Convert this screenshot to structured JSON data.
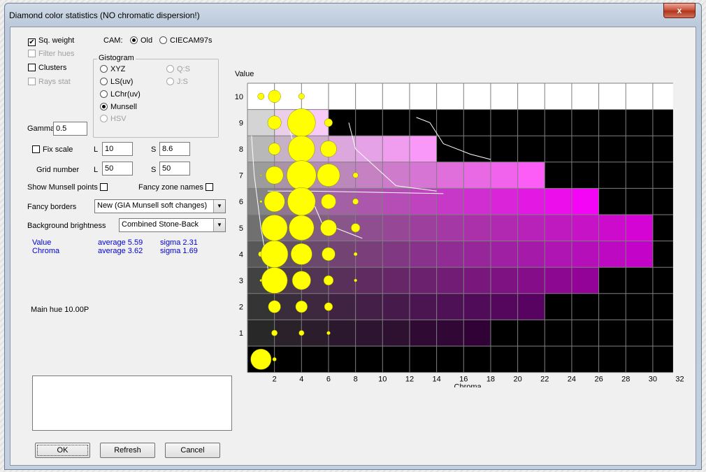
{
  "window": {
    "title": "Diamond color statistics (NO chromatic dispersion!)",
    "close_label": "x"
  },
  "options": {
    "sq_weight": {
      "label": "Sq. weight",
      "checked": true
    },
    "filter_hues": {
      "label": "Filter hues",
      "checked": false
    },
    "clusters": {
      "label": "Clusters",
      "checked": false
    },
    "rays_stat": {
      "label": "Rays stat",
      "checked": false
    },
    "cam_label": "CAM:",
    "cam_old": "Old",
    "cam_ciecam": "CIECAM97s"
  },
  "gistogram": {
    "label": "Gistogram",
    "xyz": "XYZ",
    "ls_uv": "LS(uv)",
    "lchr_uv": "LChr(uv)",
    "munsell": "Munsell",
    "hsv": "HSV",
    "qs": "Q:S",
    "js": "J:S",
    "selected": "Munsell"
  },
  "gamma": {
    "label": "Gamma",
    "value": "0.5"
  },
  "fix_scale": {
    "label": "Fix scale",
    "l_label": "L",
    "l_value": "10",
    "s_label": "S",
    "s_value": "8.6"
  },
  "grid_number": {
    "label": "Grid number",
    "l_label": "L",
    "l_value": "50",
    "s_label": "S",
    "s_value": "50"
  },
  "show_munsell_points": "Show Munsell points",
  "fancy_zone_names": "Fancy zone names",
  "fancy_borders": {
    "label": "Fancy borders",
    "value": "New (GIA Munsell soft changes)"
  },
  "background_brightness": {
    "label": "Background brightness",
    "value": "Combined Stone-Back"
  },
  "stats": {
    "value_label": "Value",
    "value_average": "average  5.59",
    "value_sigma": "sigma  2.31",
    "chroma_label": "Chroma",
    "chroma_average": "average  3.62",
    "chroma_sigma": "sigma  1.69"
  },
  "main_hue": "Main hue 10.00P",
  "buttons": {
    "ok": "OK",
    "refresh": "Refresh",
    "cancel": "Cancel"
  },
  "colors": {
    "bubble": "#ffff00",
    "bubble_outline": "#8a8a00",
    "grid_line": "#7f7f7f",
    "curve": "#ffffff"
  },
  "chart_data": {
    "type": "heatmap",
    "ylabel": "Value",
    "xlabel": "Chroma",
    "x_ticks": [
      2,
      4,
      6,
      8,
      10,
      12,
      14,
      16,
      18,
      20,
      22,
      24,
      26,
      28,
      30,
      32
    ],
    "y_ticks": [
      1,
      2,
      3,
      4,
      5,
      6,
      7,
      8,
      9,
      10
    ],
    "xlim": [
      0,
      31.5
    ],
    "ylim": [
      0,
      10
    ],
    "gamut_max_chroma": {
      "0": 0,
      "1": 18,
      "2": 22,
      "3": 26,
      "4": 30,
      "5": 30,
      "6": 26,
      "7": 22,
      "8": 14,
      "9": 6,
      "10": 30
    },
    "bubbles": [
      {
        "chroma": 1,
        "value": 10,
        "size": 0.22
      },
      {
        "chroma": 2,
        "value": 10,
        "size": 0.42
      },
      {
        "chroma": 4,
        "value": 10,
        "size": 0.2
      },
      {
        "chroma": 2,
        "value": 9,
        "size": 0.46
      },
      {
        "chroma": 4,
        "value": 9,
        "size": 0.95
      },
      {
        "chroma": 6,
        "value": 9,
        "size": 0.27
      },
      {
        "chroma": 2,
        "value": 8,
        "size": 0.4
      },
      {
        "chroma": 4,
        "value": 8,
        "size": 0.9
      },
      {
        "chroma": 6,
        "value": 8,
        "size": 0.55
      },
      {
        "chroma": 1,
        "value": 7,
        "size": 0.05
      },
      {
        "chroma": 2,
        "value": 7,
        "size": 0.6
      },
      {
        "chroma": 4,
        "value": 7,
        "size": 1.0
      },
      {
        "chroma": 6,
        "value": 7,
        "size": 0.77
      },
      {
        "chroma": 8,
        "value": 7,
        "size": 0.18
      },
      {
        "chroma": 1,
        "value": 6,
        "size": 0.08
      },
      {
        "chroma": 2,
        "value": 6,
        "size": 0.7
      },
      {
        "chroma": 4,
        "value": 6,
        "size": 0.95
      },
      {
        "chroma": 6,
        "value": 6,
        "size": 0.5
      },
      {
        "chroma": 8,
        "value": 6,
        "size": 0.2
      },
      {
        "chroma": 2,
        "value": 5,
        "size": 0.88
      },
      {
        "chroma": 4,
        "value": 5,
        "size": 0.85
      },
      {
        "chroma": 6,
        "value": 5,
        "size": 0.55
      },
      {
        "chroma": 8,
        "value": 5,
        "size": 0.3
      },
      {
        "chroma": 0,
        "value": 4,
        "size": 0.18
      },
      {
        "chroma": 2,
        "value": 4,
        "size": 0.92
      },
      {
        "chroma": 4,
        "value": 4,
        "size": 0.72
      },
      {
        "chroma": 6,
        "value": 4,
        "size": 0.45
      },
      {
        "chroma": 8,
        "value": 4,
        "size": 0.12
      },
      {
        "chroma": 0,
        "value": 3,
        "size": 0.08
      },
      {
        "chroma": 2,
        "value": 3,
        "size": 0.88
      },
      {
        "chroma": 4,
        "value": 3,
        "size": 0.63
      },
      {
        "chroma": 6,
        "value": 3,
        "size": 0.33
      },
      {
        "chroma": 8,
        "value": 3,
        "size": 0.1
      },
      {
        "chroma": 2,
        "value": 2,
        "size": 0.42
      },
      {
        "chroma": 4,
        "value": 2,
        "size": 0.4
      },
      {
        "chroma": 6,
        "value": 2,
        "size": 0.28
      },
      {
        "chroma": 2,
        "value": 1,
        "size": 0.2
      },
      {
        "chroma": 4,
        "value": 1,
        "size": 0.18
      },
      {
        "chroma": 6,
        "value": 1,
        "size": 0.12
      },
      {
        "chroma": 0,
        "value": 0,
        "size": 0.7
      },
      {
        "chroma": 2,
        "value": 0,
        "size": 0.13
      }
    ]
  }
}
